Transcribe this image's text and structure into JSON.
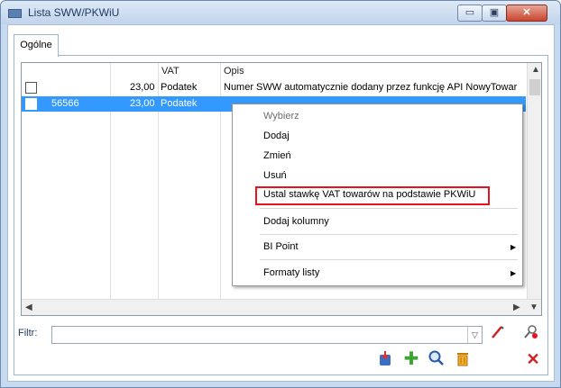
{
  "window": {
    "title": "Lista SWW/PKWiU",
    "controls": {
      "minimize": "▭",
      "maximize": "▣",
      "close": "✕"
    }
  },
  "tabs": [
    {
      "label": "Ogólne",
      "active": true
    }
  ],
  "grid": {
    "columns": [
      {
        "label": ""
      },
      {
        "label": "VAT"
      },
      {
        "label": ""
      },
      {
        "label": "Opis"
      }
    ],
    "rows": [
      {
        "checked": false,
        "code": "",
        "vat": "23,00",
        "vat_type": "Podatek",
        "opis": "Numer SWW automatycznie dodany przez funkcję API NowyTowar",
        "selected": false
      },
      {
        "checked": false,
        "code": "56566",
        "vat": "23,00",
        "vat_type": "Podatek",
        "opis": "",
        "selected": true
      }
    ],
    "scroll_arrows": {
      "up": "▲",
      "down": "▼",
      "left": "◀",
      "right": "▶"
    }
  },
  "context_menu": {
    "items": [
      {
        "label": "Wybierz",
        "disabled": true
      },
      {
        "label": "Dodaj"
      },
      {
        "label": "Zmień"
      },
      {
        "label": "Usuń"
      },
      {
        "label": "Ustal stawkę VAT towarów na podstawie PKWiU",
        "highlighted": true
      },
      {
        "label": "Dodaj kolumny"
      },
      {
        "label": "BI Point",
        "submenu": true
      },
      {
        "label": "Formaty listy",
        "submenu": true
      }
    ],
    "submenu_arrow": "▶",
    "highlight_color": "#e8121d"
  },
  "filter": {
    "label": "Filtr:",
    "value": "",
    "dropdown_arrow": "▽"
  },
  "toolbar": {
    "icons": [
      "export-icon",
      "add-icon",
      "search-icon",
      "delete-icon",
      "close-icon",
      "clear-filter-icon",
      "filter-tool-icon"
    ],
    "glyphs": {
      "add": "✚",
      "search": "🔍",
      "close": "✕"
    }
  },
  "colors": {
    "selection": "#3399ff",
    "titlebar": "#c0d4ec",
    "accent": "#e8121d"
  }
}
